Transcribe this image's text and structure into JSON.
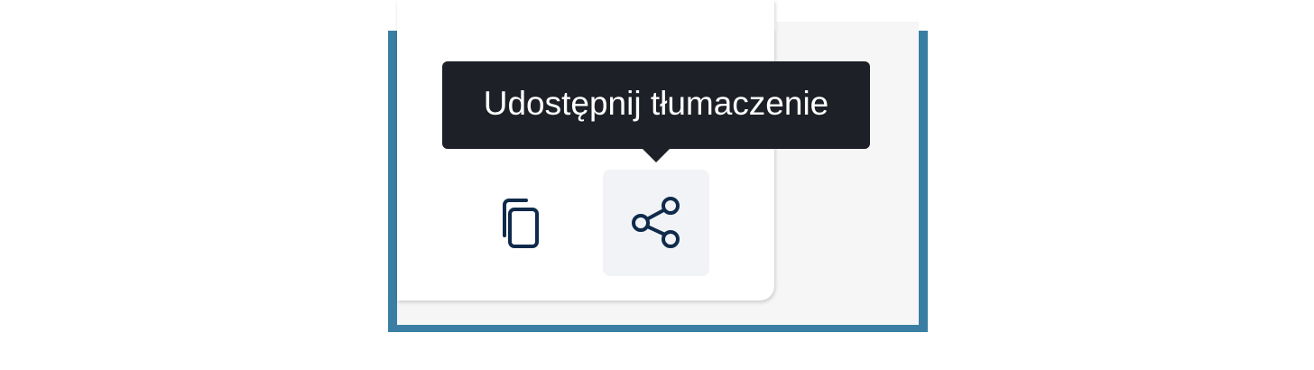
{
  "tooltip": {
    "text": "Udostępnij tłumaczenie"
  },
  "toolbar": {
    "copy_icon": "copy-icon",
    "share_icon": "share-icon"
  },
  "colors": {
    "frame_border": "#3a7fa3",
    "tooltip_bg": "#1d2027",
    "tooltip_text": "#ffffff",
    "icon_stroke": "#0f2a4a",
    "hover_bg": "#f1f3f6"
  }
}
